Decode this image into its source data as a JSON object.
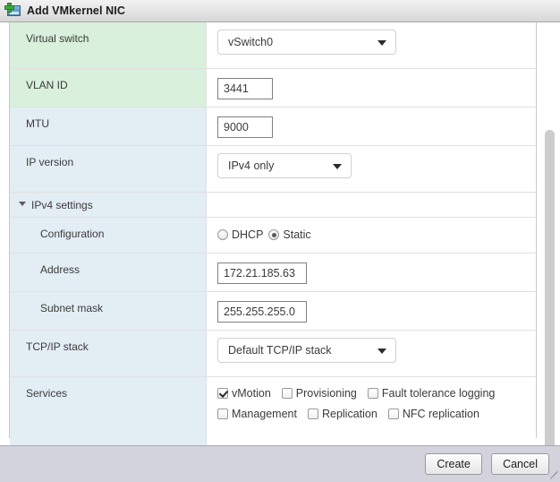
{
  "window": {
    "title": "Add VMkernel NIC",
    "icon": "network-card-add-icon"
  },
  "form": {
    "rows": [
      {
        "label": "Virtual switch",
        "control": "select",
        "value": "vSwitch0"
      },
      {
        "label": "VLAN ID",
        "control": "text",
        "value": "3441"
      },
      {
        "label": "MTU",
        "control": "text",
        "value": "9000"
      },
      {
        "label": "IP version",
        "control": "select",
        "value": "IPv4 only"
      },
      {
        "label": "IPv4 settings",
        "control": "section"
      },
      {
        "label": "Configuration",
        "control": "radio"
      },
      {
        "label": "Address",
        "control": "text",
        "value": "172.21.185.63"
      },
      {
        "label": "Subnet mask",
        "control": "text",
        "value": "255.255.255.0"
      },
      {
        "label": "TCP/IP stack",
        "control": "select",
        "value": "Default TCP/IP stack"
      },
      {
        "label": "Services",
        "control": "checkboxes"
      }
    ],
    "labels": {
      "virtual_switch": "Virtual switch",
      "vlan_id": "VLAN ID",
      "mtu": "MTU",
      "ip_version": "IP version",
      "ipv4_settings": "IPv4 settings",
      "configuration": "Configuration",
      "address": "Address",
      "subnet_mask": "Subnet mask",
      "tcpip_stack": "TCP/IP stack",
      "services": "Services"
    },
    "values": {
      "virtual_switch": "vSwitch0",
      "vlan_id": "3441",
      "mtu": "9000",
      "ip_version": "IPv4 only",
      "address": "172.21.185.63",
      "subnet_mask": "255.255.255.0",
      "tcpip_stack": "Default TCP/IP stack"
    },
    "configuration_options": [
      {
        "label": "DHCP",
        "selected": false
      },
      {
        "label": "Static",
        "selected": true
      }
    ],
    "services_options": [
      {
        "label": "vMotion",
        "checked": true
      },
      {
        "label": "Provisioning",
        "checked": false
      },
      {
        "label": "Fault tolerance logging",
        "checked": false
      },
      {
        "label": "Management",
        "checked": false
      },
      {
        "label": "Replication",
        "checked": false
      },
      {
        "label": "NFC replication",
        "checked": false
      }
    ]
  },
  "footer": {
    "create_label": "Create",
    "cancel_label": "Cancel"
  },
  "colors": {
    "label_green": "#d9f0dc",
    "label_blue": "#e3edf4",
    "footer": "#d3d3dd",
    "titlebar": "#e4e4e4"
  }
}
